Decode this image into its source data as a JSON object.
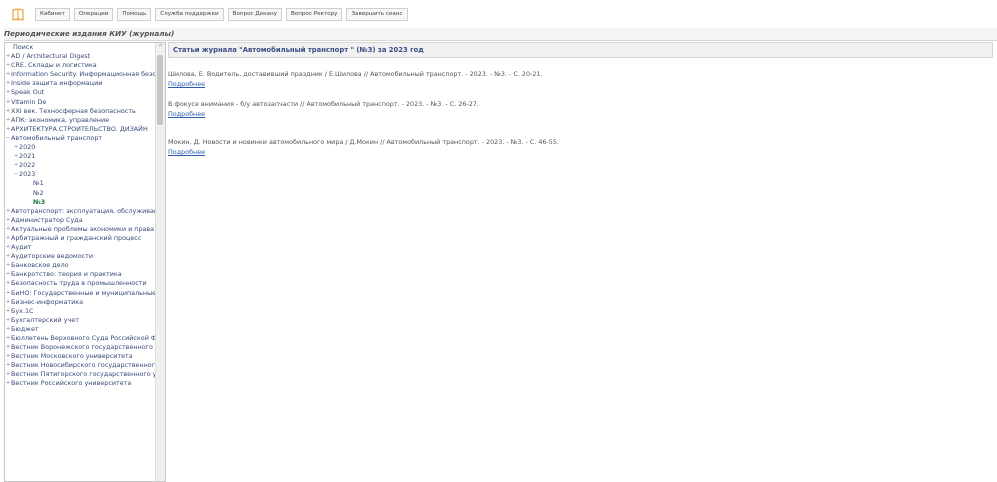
{
  "topbar": {
    "logo_icon": "book-logo-icon",
    "menu": [
      {
        "label": "Кабинет"
      },
      {
        "label": "Операции"
      },
      {
        "label": "Помощь"
      },
      {
        "label": "Служба поддержки"
      },
      {
        "label": "Вопрос Декану"
      },
      {
        "label": "Вопрос Ректору"
      },
      {
        "label": "Завершить сеанс"
      }
    ]
  },
  "section_title": "Периодические издания КИУ (журналы)",
  "sidebar": {
    "search_label": "Поиск",
    "items": [
      {
        "label": "AD / Architectural Digest",
        "expander": "+"
      },
      {
        "label": "CRE. Склады и логистика",
        "expander": "+"
      },
      {
        "label": "Information Security. Информационная безопасность",
        "expander": "+"
      },
      {
        "label": "Inside защита информации",
        "expander": "+"
      },
      {
        "label": "Speak Out",
        "expander": "+"
      },
      {
        "label": "Vitamin De",
        "expander": "+"
      },
      {
        "label": "XXI век. Техносферная безопасность",
        "expander": "+"
      },
      {
        "label": "АПК: экономика, управление",
        "expander": "+"
      },
      {
        "label": "АРХИТЕКТУРА.СТРОИТЕЛЬСТВО. ДИЗАЙН",
        "expander": "+"
      },
      {
        "label": "Автомобильный транспорт",
        "expander": "−"
      }
    ],
    "years": [
      {
        "label": "2020",
        "expander": "+"
      },
      {
        "label": "2021",
        "expander": "+"
      },
      {
        "label": "2022",
        "expander": "+"
      },
      {
        "label": "2023",
        "expander": "−"
      }
    ],
    "issues": [
      {
        "label": "№1"
      },
      {
        "label": "№2"
      },
      {
        "label": "№3"
      }
    ],
    "items_after": [
      {
        "label": "Автотранспорт: эксплуатация, обслуживание, ремонт",
        "expander": "+"
      },
      {
        "label": "Администратор Суда",
        "expander": "+"
      },
      {
        "label": "Актуальные проблемы экономики и права",
        "expander": "+"
      },
      {
        "label": "Арбитражный и гражданский процесс",
        "expander": "+"
      },
      {
        "label": "Аудит",
        "expander": "+"
      },
      {
        "label": "Аудиторские ведомости",
        "expander": "+"
      },
      {
        "label": "Банковское дело",
        "expander": "+"
      },
      {
        "label": "Банкротство: теория и практика",
        "expander": "+"
      },
      {
        "label": "Безопасность труда в промышленности",
        "expander": "+"
      },
      {
        "label": "БиНО: Государственные и муниципальные учреждения",
        "expander": "+"
      },
      {
        "label": "Бизнес-информатика",
        "expander": "+"
      },
      {
        "label": "Бух.1С",
        "expander": "+"
      },
      {
        "label": "Бухгалтерский учет",
        "expander": "+"
      },
      {
        "label": "Бюджет",
        "expander": "+"
      },
      {
        "label": "Бюллетень Верховного Суда Российской Федерации",
        "expander": "+"
      },
      {
        "label": "Вестник Воронежского государственного университета",
        "expander": "+"
      },
      {
        "label": "Вестник Московского университета",
        "expander": "+"
      },
      {
        "label": "Вестник Новосибирского государственного университета",
        "expander": "+"
      },
      {
        "label": "Вестник Пятигорского государственного университета",
        "expander": "+"
      },
      {
        "label": "Вестник Российского университета",
        "expander": "+"
      }
    ]
  },
  "content": {
    "header": "Статьи журнала \"Автомобильный транспорт \" (№3) за 2023 год",
    "more_label": "Подробнее",
    "articles": [
      {
        "text": "Шилова, Е. Водитель, доставивший праздник / Е.Шилова // Автомобильный транспорт. - 2023. - №3. - С. 20-21."
      },
      {
        "text": "В фокусе внимания - б/у автозапчасти // Автомобильный транспорт. - 2023. - №3. - С. 26-27."
      },
      {
        "text": "Мокин, Д. Новости и новинки автомобильного мира / Д.Мокин // Автомобильный транспорт. - 2023. - №3. - С. 46-55."
      }
    ]
  },
  "colors": {
    "link": "#2a5db0",
    "header_text": "#3b4f86",
    "selected_issue": "#1a7a3a",
    "logo": "#e8a23a"
  }
}
